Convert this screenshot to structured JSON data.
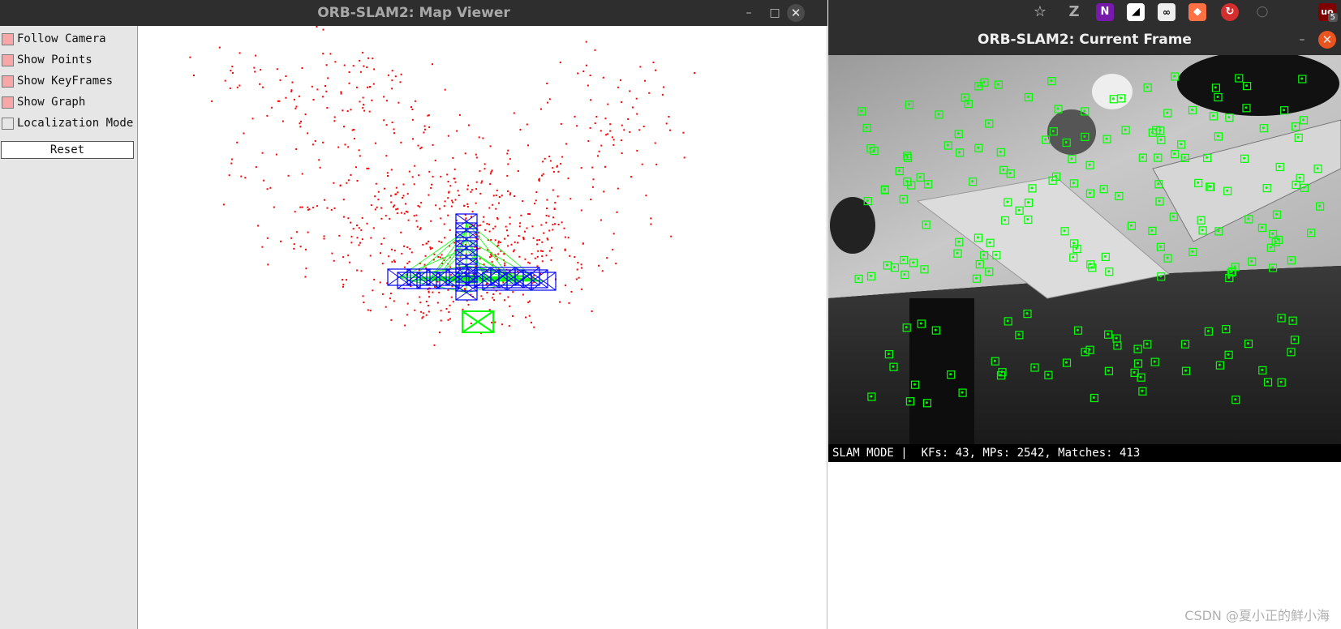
{
  "map_window": {
    "title": "ORB-SLAM2: Map Viewer",
    "minimize_glyph": "–",
    "maximize_glyph": "□",
    "close_glyph": "✕",
    "panel": {
      "options": [
        {
          "label": "Follow Camera",
          "checked": true
        },
        {
          "label": "Show Points",
          "checked": true
        },
        {
          "label": "Show KeyFrames",
          "checked": true
        },
        {
          "label": "Show Graph",
          "checked": true
        },
        {
          "label": "Localization Mode",
          "checked": false
        }
      ],
      "reset_label": "Reset"
    },
    "colors": {
      "points": "#ff0000",
      "keyframes": "#0000ff",
      "graph": "#00ff00",
      "current_camera": "#00ff00"
    }
  },
  "browser_toolbar": {
    "icons": [
      "star-icon",
      "zotero-icon",
      "onenote-icon",
      "notion-icon",
      "privacy-icon",
      "extension-orange-icon",
      "extension-red-icon",
      "mouse-icon",
      "ublock-icon"
    ],
    "badge": "5"
  },
  "frame_window": {
    "title": "ORB-SLAM2: Current Frame",
    "minimize_glyph": "–",
    "close_glyph": "✕",
    "status": "SLAM MODE |  KFs: 43, MPs: 2542, Matches: 413",
    "feature_color": "#00ff00"
  },
  "watermark": "CSDN @夏小正的鲜小海"
}
